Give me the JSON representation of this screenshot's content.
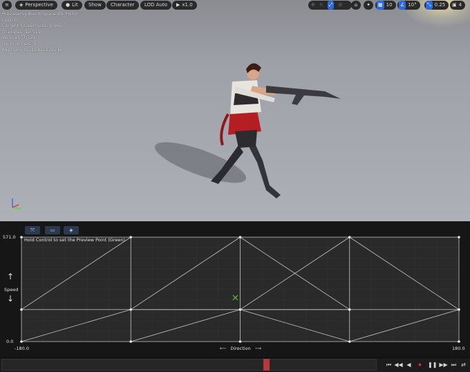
{
  "viewport_toolbar": {
    "menu_icon": "hamburger-icon",
    "perspective_label": "Perspective",
    "lit_label": "Lit",
    "show_label": "Show",
    "character_label": "Character",
    "lod_label": "LOD Auto",
    "speed_label": "x1.0",
    "grid_snap_value": "10",
    "rotation_snap_value": "10°",
    "scale_snap_value": "0.25",
    "camera_speed_value": "4"
  },
  "stats": {
    "line1": "Previewing Blend Space BS_Pistol",
    "line2": "LOD: 0",
    "line3": "Current Screen Size: 0.982",
    "line4": "Triangles: 12,519",
    "line5": "Vertices: 7,721",
    "line6": "UV Channels: 1",
    "line7": "Approx Size: 104x122x216"
  },
  "editor": {
    "hint": "Hold Control to set the Preview Point (Green)",
    "y_axis_label": "Speed",
    "x_axis_label": "Direction",
    "y_max_label": "571.0",
    "y_min_label": "0.0",
    "x_min_label": "-180.0",
    "x_max_label": "180.0"
  },
  "chart_data": {
    "type": "scatter",
    "xlabel": "Direction",
    "ylabel": "Speed",
    "xlim": [
      -180,
      180
    ],
    "ylim": [
      0,
      571
    ],
    "samples": [
      {
        "x": -180,
        "y": 571
      },
      {
        "x": -90,
        "y": 571
      },
      {
        "x": 0,
        "y": 571
      },
      {
        "x": 90,
        "y": 571
      },
      {
        "x": 180,
        "y": 571
      },
      {
        "x": -180,
        "y": 175
      },
      {
        "x": -90,
        "y": 175
      },
      {
        "x": 0,
        "y": 175
      },
      {
        "x": 90,
        "y": 175
      },
      {
        "x": 180,
        "y": 175
      },
      {
        "x": -180,
        "y": 0
      },
      {
        "x": -90,
        "y": 0
      },
      {
        "x": 0,
        "y": 0
      },
      {
        "x": 90,
        "y": 0
      },
      {
        "x": 180,
        "y": 0
      }
    ],
    "triangles": [
      [
        -180,
        175,
        -90,
        571
      ],
      [
        -90,
        175,
        0,
        571
      ],
      [
        0,
        175,
        90,
        571
      ],
      [
        90,
        571,
        180,
        175
      ],
      [
        0,
        571,
        90,
        175
      ],
      [
        -180,
        0,
        -90,
        175
      ],
      [
        -90,
        175,
        0,
        175
      ],
      [
        0,
        175,
        90,
        0
      ],
      [
        90,
        0,
        180,
        175
      ],
      [
        -90,
        0,
        0,
        175
      ],
      [
        0,
        175,
        90,
        175
      ]
    ],
    "preview_point": {
      "x": -4,
      "y": 240
    },
    "grid": true,
    "colors": {
      "lines": "#c8c8c8",
      "points": "#e6e6e6",
      "preview": "#6fcf3c",
      "background": "#2a2a2a"
    }
  },
  "timeline": {
    "scrub_position": 0.71,
    "buttons": [
      "skip-to-start-icon",
      "step-back-icon",
      "play-reverse-icon",
      "record-icon",
      "pause-icon",
      "step-forward-icon",
      "skip-to-end-icon",
      "loop-icon"
    ]
  },
  "colors": {
    "accent_blue": "#2c6bd8",
    "record_red": "#e23434"
  }
}
